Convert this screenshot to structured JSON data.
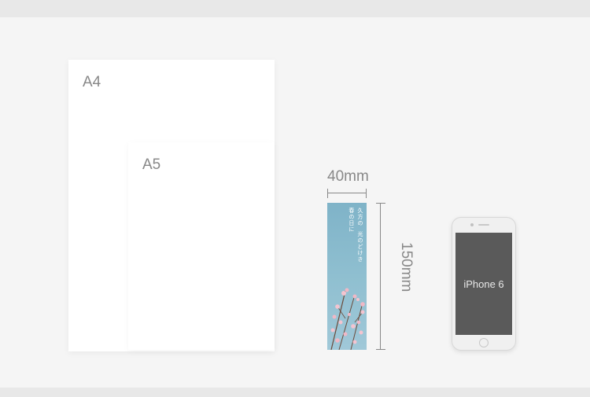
{
  "papers": {
    "a4_label": "A4",
    "a5_label": "A5"
  },
  "bookmark": {
    "width_label": "40mm",
    "height_label": "150mm",
    "poem_line1": "久方の",
    "poem_line2": "光のどけき",
    "poem_line3": "春の日に"
  },
  "phone": {
    "model_label": "iPhone 6"
  }
}
